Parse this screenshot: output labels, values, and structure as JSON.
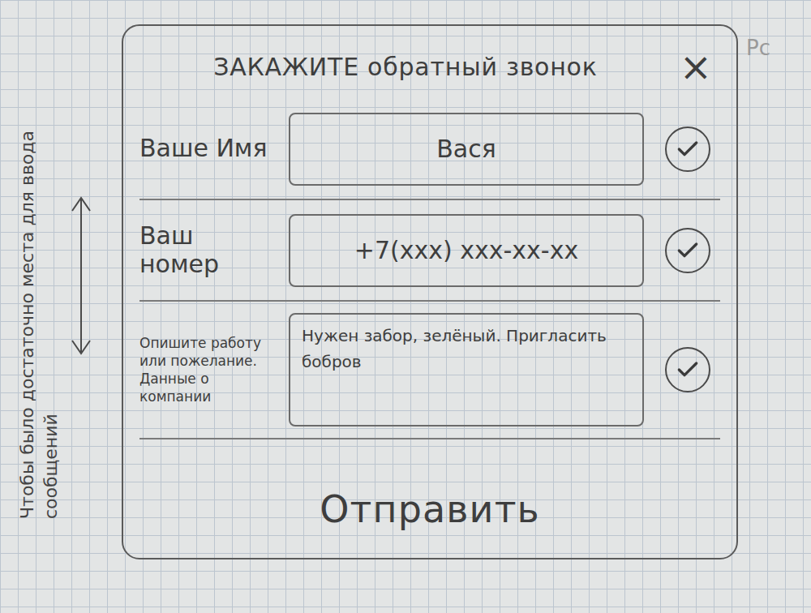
{
  "annotation": {
    "note": "Чтобы было достаточно места для ввода сообщений",
    "corner": "Pc"
  },
  "dialog": {
    "title": "ЗАКАЖИТЕ обратный звонок",
    "close": "×"
  },
  "fields": [
    {
      "label": "Ваше Имя",
      "value": "Вася",
      "valid": true,
      "kind": "input"
    },
    {
      "label": "Ваш номер",
      "value": "+7(xxx) xxx-xx-xx",
      "valid": true,
      "kind": "input"
    },
    {
      "label": "Опишите работу или пожелание. Данные о компании",
      "value": "Нужен забор, зелёный. Пригласить бобров",
      "valid": true,
      "kind": "textarea"
    }
  ],
  "submit": "Отправить"
}
